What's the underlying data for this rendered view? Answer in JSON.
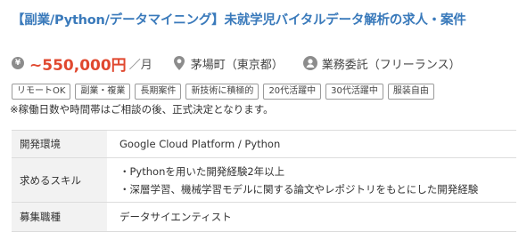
{
  "title": "【副業/Python/データマイニング】未就学児バイタルデータ解析の求人・案件",
  "meta": {
    "yen_icon_glyph": "¥",
    "price": "~550,000円",
    "per": "／月",
    "location": "茅場町（東京都）",
    "contract": "業務委託（フリーランス）"
  },
  "tags": [
    "リモートOK",
    "副業・複業",
    "長期案件",
    "新技術に積極的",
    "20代活躍中",
    "30代活躍中",
    "服装自由"
  ],
  "note": "※稼働日数や時間帯はご相談の後、正式決定となります。",
  "table": {
    "rows": [
      {
        "label": "開発環境",
        "values": [
          "Google Cloud Platform / Python"
        ]
      },
      {
        "label": "求めるスキル",
        "values": [
          "・Pythonを用いた開発経験2年以上",
          "・深層学習、機械学習モデルに関する論文やレポジトリをもとにした開発経験"
        ]
      },
      {
        "label": "募集職種",
        "values": [
          "データサイエンティスト"
        ]
      }
    ]
  },
  "colors": {
    "title": "#3a7abb",
    "price": "#e0482f",
    "icon": "#8c8c8c",
    "header_bg": "#f2f2f2"
  }
}
